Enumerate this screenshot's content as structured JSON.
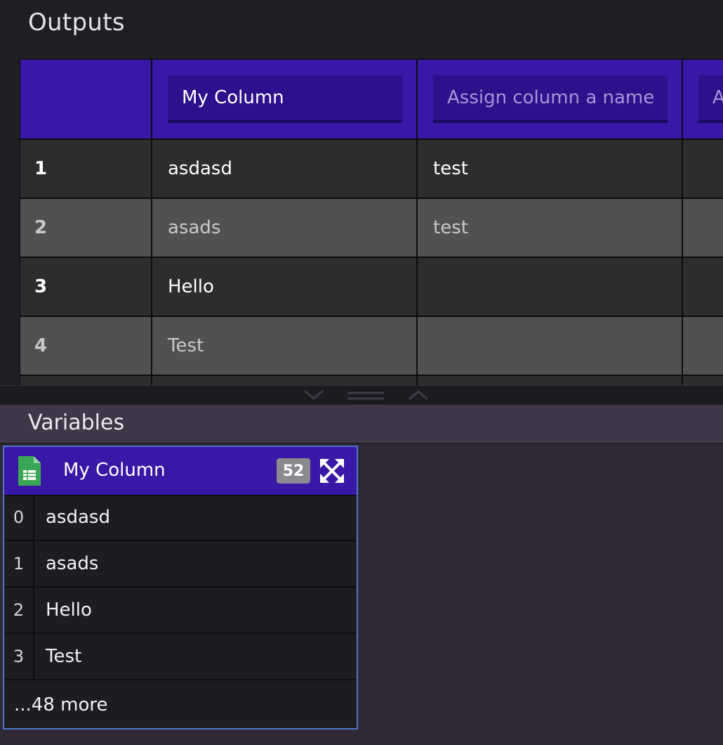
{
  "outputs": {
    "title": "Outputs",
    "columns": [
      {
        "value": "My Column",
        "placeholder": "Assign column a name"
      },
      {
        "value": "",
        "placeholder": "Assign column a name"
      },
      {
        "value": "",
        "placeholder": "Assign column a name"
      }
    ],
    "rows": [
      {
        "index": "1",
        "cells": [
          "asdasd",
          "test",
          ""
        ]
      },
      {
        "index": "2",
        "cells": [
          "asads",
          "test",
          ""
        ]
      },
      {
        "index": "3",
        "cells": [
          "Hello",
          "",
          ""
        ]
      },
      {
        "index": "4",
        "cells": [
          "Test",
          "",
          ""
        ]
      }
    ]
  },
  "resizer": {
    "collapse_icon": "chevron-down-icon",
    "drag_icon": "drag-handle-icon",
    "expand_icon": "chevron-up-icon"
  },
  "variables": {
    "title": "Variables",
    "card": {
      "icon": "spreadsheet-icon",
      "name": "My Column",
      "count": "52",
      "expand_icon": "expand-arrows-icon",
      "rows": [
        {
          "index": "0",
          "value": "asdasd"
        },
        {
          "index": "1",
          "value": "asads"
        },
        {
          "index": "2",
          "value": "Hello"
        },
        {
          "index": "3",
          "value": "Test"
        }
      ],
      "more": "...48 more"
    }
  },
  "colors": {
    "accent": "#3a17a7",
    "card_border": "#4d79c9",
    "sheet_icon": "#3aa757"
  }
}
